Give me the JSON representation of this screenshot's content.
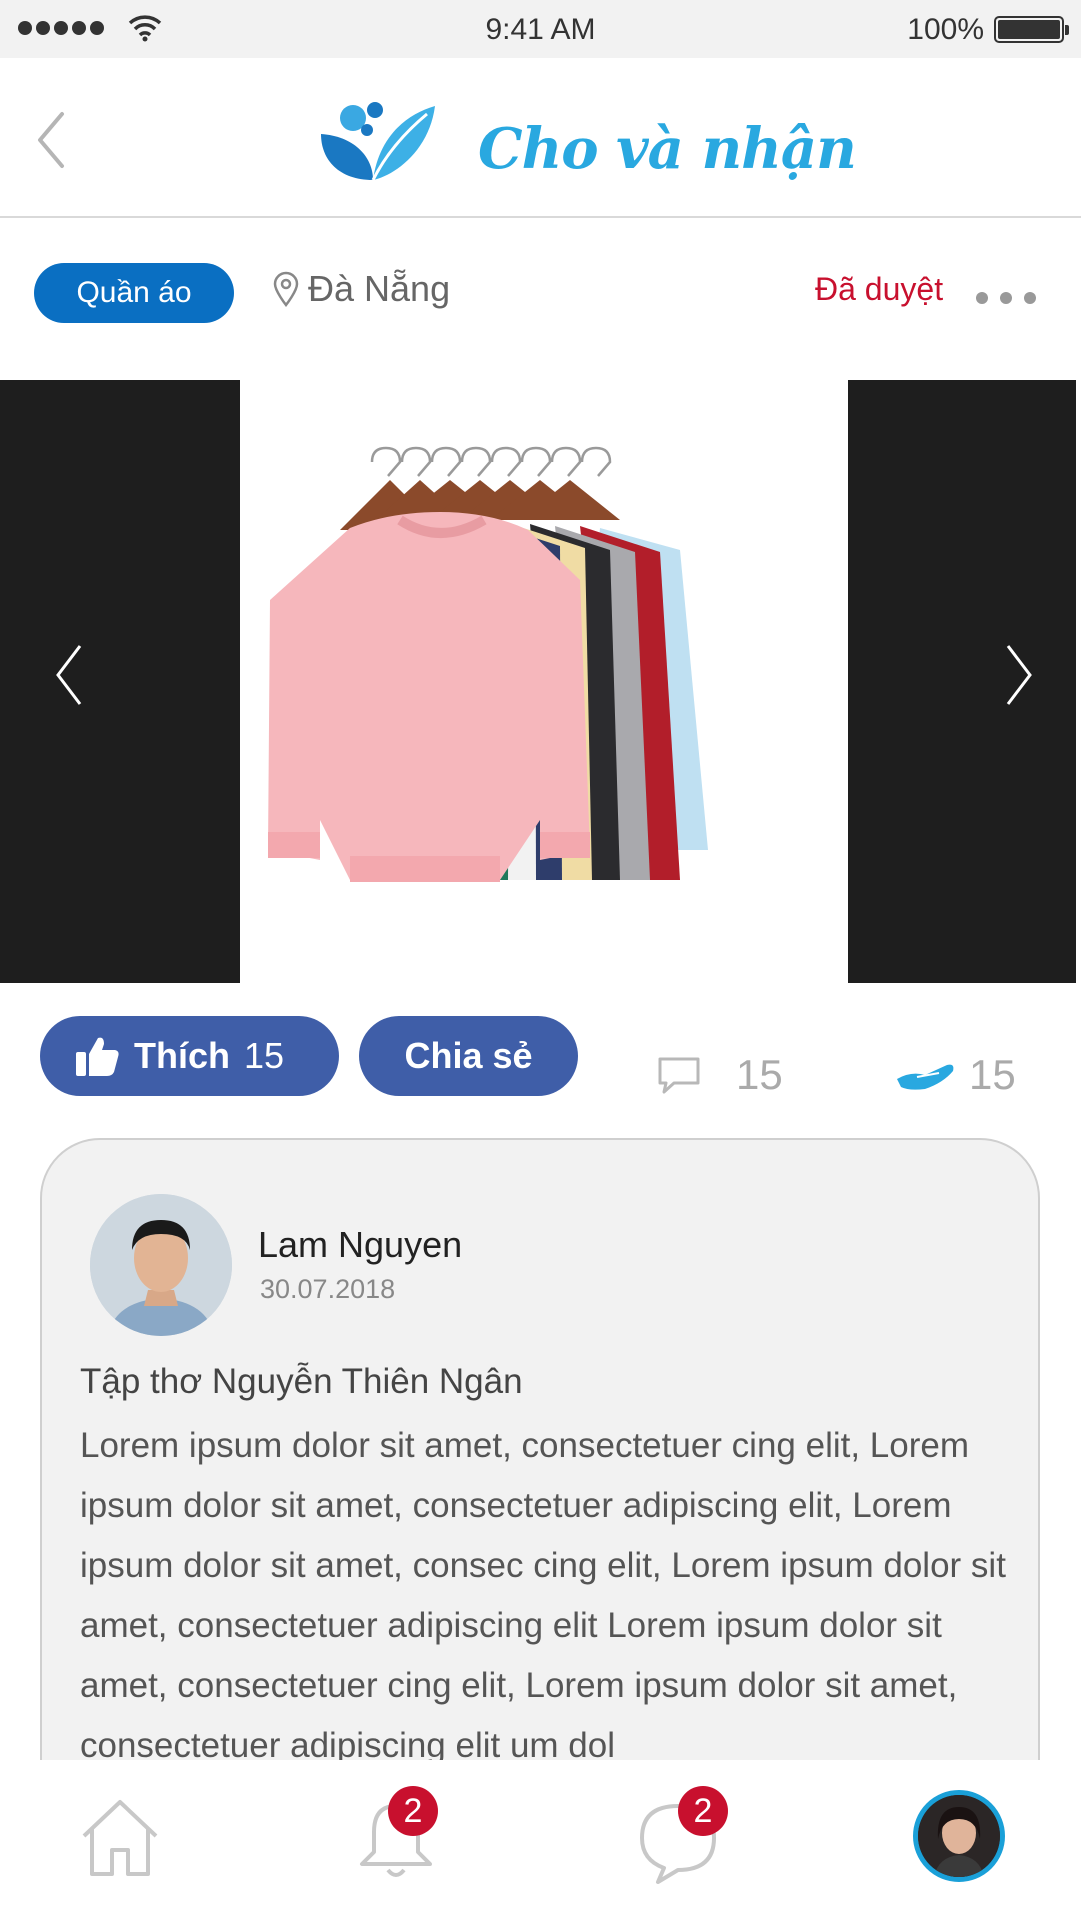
{
  "status_bar": {
    "time": "9:41 AM",
    "battery": "100%"
  },
  "header": {
    "title": "Cho và nhận"
  },
  "post_meta": {
    "category": "Quần áo",
    "location": "Đà Nẵng",
    "status": "Đã duyệt"
  },
  "actions": {
    "like_label": "Thích",
    "like_count": "15",
    "share_label": "Chia sẻ",
    "comment_count": "15",
    "give_count": "15"
  },
  "post": {
    "author": "Lam Nguyen",
    "date": "30.07.2018",
    "title": "Tập thơ Nguyễn Thiên Ngân",
    "body": "Lorem ipsum dolor sit amet, consectetuer  cing elit, Lorem ipsum dolor sit amet, consectetuer adipiscing elit, Lorem ipsum dolor sit amet, consec cing elit, Lorem ipsum dolor sit amet, consectetuer adipiscing elit Lorem ipsum dolor sit amet, consectetuer cing elit, Lorem ipsum dolor sit amet, consectetuer adipiscing elit um dol"
  },
  "tab_bar": {
    "notification_badge": "2",
    "message_badge": "2"
  },
  "colors": {
    "accent": "#29a8e0",
    "primary_button": "#3f5ea8",
    "category_pill": "#0a6fc2",
    "status_red": "#c8102e"
  }
}
